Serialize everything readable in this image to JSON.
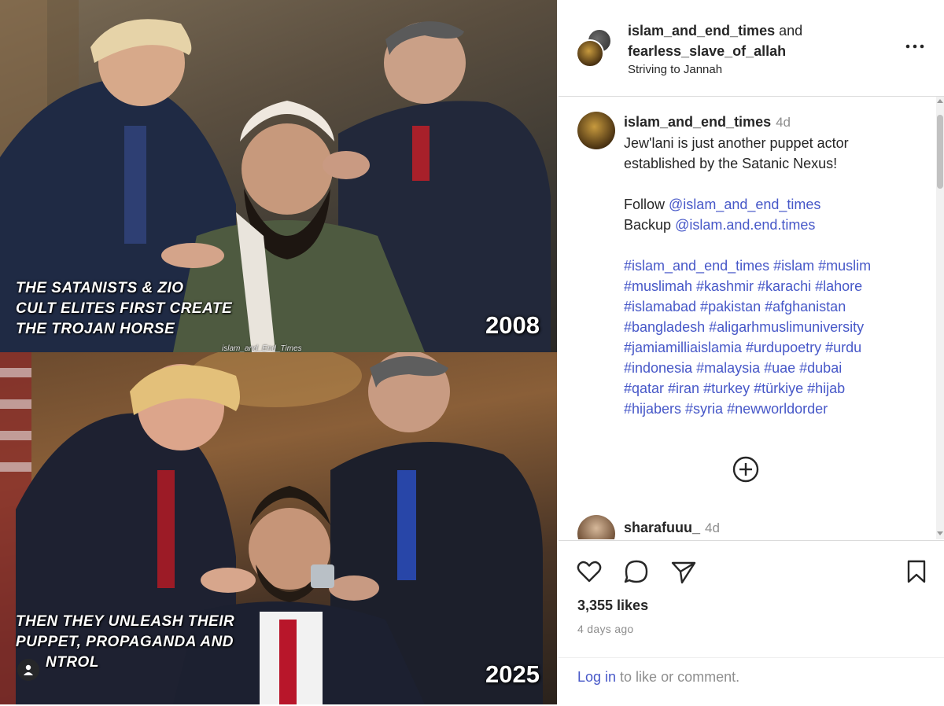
{
  "post": {
    "header": {
      "user1": "islam_and_end_times",
      "connector": "and",
      "user2": "fearless_slave_of_allah",
      "subtitle": "Striving to Jannah"
    },
    "image": {
      "top_caption_lines": [
        "THE  SATANISTS & ZIO",
        "CULT ELITES FIRST CREATE",
        "THE TROJAN HORSE"
      ],
      "top_year": "2008",
      "watermark": "islam_and_End_Times",
      "bottom_caption_lines": [
        "THEN THEY UNLEASH THEIR",
        "PUPPET, PROPAGANDA AND",
        "NTROL"
      ],
      "bottom_year": "2025"
    },
    "caption_comment": {
      "username": "islam_and_end_times",
      "time": "4d",
      "line1": "Jew'lani is just another puppet actor",
      "line2": "established by the Satanic Nexus!",
      "follow_label": "Follow",
      "follow_handle": "@islam_and_end_times",
      "backup_label": "Backup",
      "backup_handle": "@islam.and.end.times",
      "hashtag_lines": [
        "#islam_and_end_times #islam #muslim",
        "#muslimah #kashmir #karachi #lahore",
        "#islamabad #pakistan #afghanistan",
        "#bangladesh #aligarhmuslimuniversity",
        "#jamiamilliaislamia #urdupoetry #urdu",
        "#indonesia #malaysia #uae #dubai",
        "#qatar #iran #turkey #türkiye #hijab",
        "#hijabers #syria #newworldorder"
      ]
    },
    "second_comment": {
      "username": "sharafuuu_",
      "time": "4d"
    },
    "likes": "3,355 likes",
    "posted": "4 days ago",
    "login": {
      "link": "Log in",
      "rest": " to like or comment."
    },
    "icons": [
      "more-icon",
      "add-comments-icon",
      "heart-icon",
      "comment-icon",
      "share-icon",
      "bookmark-icon",
      "user-tag-icon"
    ]
  },
  "colors": {
    "link": "#4758c8",
    "muted": "#8e8e8e",
    "text": "#262626",
    "divider": "#dbdbdb"
  }
}
